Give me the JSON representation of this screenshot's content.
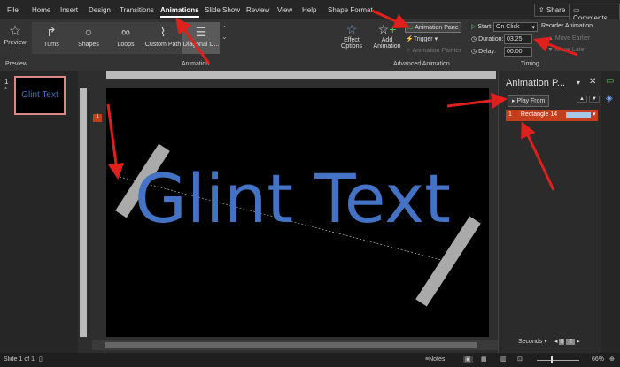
{
  "tabs": [
    "File",
    "Home",
    "Insert",
    "Design",
    "Transitions",
    "Animations",
    "Slide Show",
    "Review",
    "View",
    "Help",
    "Shape Format"
  ],
  "active_tab": "Animations",
  "share_label": "Share",
  "comments_label": "Comments",
  "preview": {
    "label": "Preview",
    "group": "Preview"
  },
  "gallery": [
    "Turns",
    "Shapes",
    "Loops",
    "Custom Path",
    "Diagonal D..."
  ],
  "animation_group": "Animation",
  "effect_options": "Effect Options",
  "add_animation": "Add Animation",
  "animation_pane_btn": "Animation Pane",
  "trigger": "Trigger",
  "animation_painter": "Animation Painter",
  "advanced_group": "Advanced Animation",
  "timing": {
    "start_label": "Start:",
    "start_value": "On Click",
    "duration_label": "Duration:",
    "duration_value": "03.25",
    "delay_label": "Delay:",
    "delay_value": "00.00",
    "reorder": "Reorder Animation",
    "move_earlier": "Move Earlier",
    "move_later": "Move Later",
    "group": "Timing"
  },
  "thumb": {
    "number": "1",
    "star": "*",
    "text": "Glint Text"
  },
  "slide_text": "Glint Text",
  "anim_tag": "1",
  "pane": {
    "title": "Animation P...",
    "play_from": "Play From",
    "item_number": "1",
    "item_name": "Rectangle 14",
    "seconds": "Seconds",
    "scale_0": "0",
    "scale_2": "2"
  },
  "status": {
    "slide": "Slide 1 of 1",
    "notes": "Notes",
    "zoom": "66%"
  },
  "colors": {
    "accent_red": "#c43e1c",
    "text_blue": "#4472c4",
    "arrow": "#e0201c"
  }
}
